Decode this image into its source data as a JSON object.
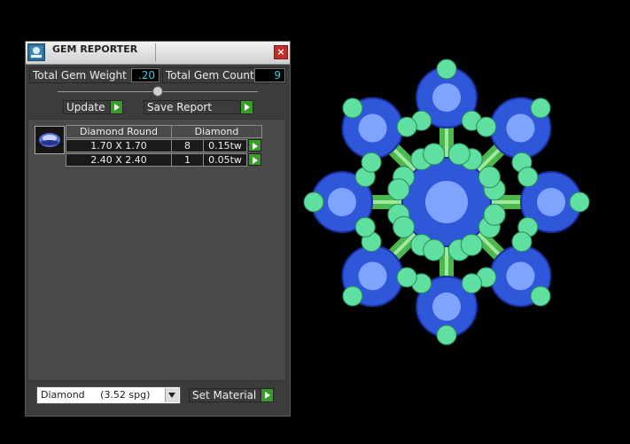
{
  "window": {
    "title": "GEM REPORTER",
    "close_label": "×"
  },
  "summary": {
    "total_weight_label": "Total Gem Weight",
    "total_weight_value": ".20",
    "total_count_label": "Total Gem Count",
    "total_count_value": "9"
  },
  "actions": {
    "update_label": "Update",
    "save_report_label": "Save Report"
  },
  "gem_table": {
    "headers": [
      "Diamond Round",
      "Diamond"
    ],
    "rows": [
      {
        "size": "1.70 X 1.70",
        "count": "8",
        "weight": "0.15tw"
      },
      {
        "size": "2.40 X 2.40",
        "count": "1",
        "weight": "0.05tw"
      }
    ]
  },
  "material": {
    "selected": "Diamond     (3.52 spg)",
    "set_material_label": "Set Material"
  },
  "colors": {
    "stone_blue": "#2f57d9",
    "prong_green": "#5fe0a0",
    "bar_green": "#4cb84c",
    "button_green": "#3a9a2a",
    "value_cyan": "#3ec8e0"
  }
}
